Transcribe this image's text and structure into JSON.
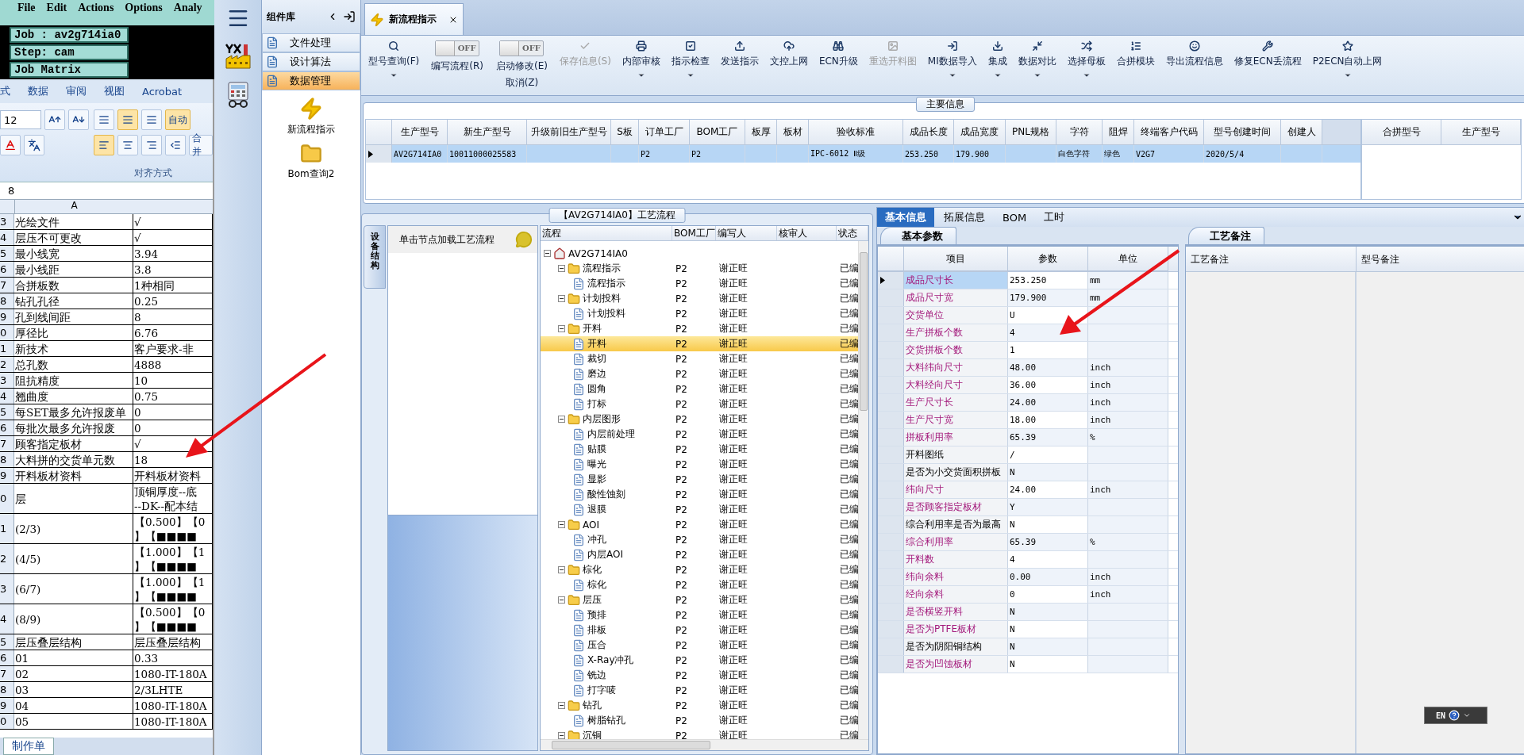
{
  "terminal": {
    "menu": [
      "File",
      "Edit",
      "Actions",
      "Options",
      "Analy"
    ],
    "job": "Job : av2g714ia0",
    "step": "Step: cam",
    "matrix": "Job Matrix"
  },
  "spreadsheet": {
    "ribbon_tabs": [
      "式",
      "数据",
      "审阅",
      "视图",
      "Acrobat"
    ],
    "font_size": "12",
    "wrap_button": "自动",
    "merge_button": "合并",
    "group_label": "对齐方式",
    "formula_value": "8",
    "column_header": "A",
    "rows": [
      {
        "num": "3",
        "a": "光绘文件",
        "b": "√"
      },
      {
        "num": "4",
        "a": "层压不可更改",
        "b": "√"
      },
      {
        "num": "5",
        "a": "最小线宽",
        "b": "3.94"
      },
      {
        "num": "6",
        "a": "最小线距",
        "b": "3.8"
      },
      {
        "num": "7",
        "a": "合拼板数",
        "b": "1种相同"
      },
      {
        "num": "8",
        "a": "钻孔孔径",
        "b": "0.25"
      },
      {
        "num": "9",
        "a": "孔到线间距",
        "b": "8"
      },
      {
        "num": "0",
        "a": "厚径比",
        "b": "6.76"
      },
      {
        "num": "1",
        "a": "新技术",
        "b": "客户要求-非"
      },
      {
        "num": "2",
        "a": "总孔数",
        "b": "4888"
      },
      {
        "num": "3",
        "a": "阻抗精度",
        "b": "10"
      },
      {
        "num": "4",
        "a": "翘曲度",
        "b": "0.75"
      },
      {
        "num": "5",
        "a": "每SET最多允许报废单",
        "b": "0"
      },
      {
        "num": "6",
        "a": "每批次最多允许报废",
        "b": "0"
      },
      {
        "num": "7",
        "a": "顾客指定板材",
        "b": "√"
      },
      {
        "num": "8",
        "a": "大料拼的交货单元数",
        "b": "18"
      },
      {
        "num": "9",
        "a": "开料板材资料",
        "b": "开料板材资料"
      },
      {
        "num": "0",
        "a": "层",
        "b": "顶铜厚度--底",
        "b2": "--DK--配本结"
      },
      {
        "num": "1",
        "a": "(2/3)",
        "b": "【0.500】【0",
        "b2": "】【■■■■"
      },
      {
        "num": "2",
        "a": "(4/5)",
        "b": "【1.000】【1",
        "b2": "】【■■■■"
      },
      {
        "num": "3",
        "a": "(6/7)",
        "b": "【1.000】【1",
        "b2": "】【■■■■"
      },
      {
        "num": "4",
        "a": "(8/9)",
        "b": "【0.500】【0",
        "b2": "】【■■■■"
      },
      {
        "num": "5",
        "a": "层压叠层结构",
        "b": "层压叠层结构"
      },
      {
        "num": "6",
        "a": "01",
        "b": "0.33"
      },
      {
        "num": "7",
        "a": "02",
        "b": "1080-IT-180A"
      },
      {
        "num": "8",
        "a": "03",
        "b": "2/3LHTE"
      },
      {
        "num": "9",
        "a": "04",
        "b": "1080-IT-180A"
      },
      {
        "num": "0",
        "a": "05",
        "b": "1080-IT-180A"
      }
    ],
    "sheet_tab": "制作单"
  },
  "component_panel": {
    "title": "组件库",
    "categories": [
      {
        "label": "文件处理",
        "selected": false
      },
      {
        "label": "设计算法",
        "selected": false
      },
      {
        "label": "数据管理",
        "selected": true
      }
    ],
    "modules": [
      {
        "label": "新流程指示",
        "kind": "flow"
      },
      {
        "label": "Bom查询2",
        "kind": "folder"
      }
    ]
  },
  "document_tab": {
    "title": "新流程指示"
  },
  "toolbar": [
    {
      "kind": "button",
      "label": "型号查询(F)",
      "dropdown": true,
      "disabled": false
    },
    {
      "kind": "toggle",
      "label": "编写流程(R)",
      "state_text": "OFF",
      "on": false
    },
    {
      "kind": "toggle",
      "label": "启动修改(E)",
      "sublabel": "取消(Z)",
      "state_text": "OFF",
      "on": false
    },
    {
      "kind": "button",
      "label": "保存信息(S)",
      "dropdown": false,
      "disabled": true
    },
    {
      "kind": "button",
      "label": "内部审核",
      "dropdown": true,
      "disabled": false
    },
    {
      "kind": "button",
      "label": "指示检查",
      "dropdown": true,
      "disabled": false
    },
    {
      "kind": "button",
      "label": "发送指示",
      "dropdown": false,
      "disabled": false
    },
    {
      "kind": "button",
      "label": "文控上网",
      "dropdown": false,
      "disabled": false
    },
    {
      "kind": "button",
      "label": "ECN升级",
      "dropdown": false,
      "disabled": false
    },
    {
      "kind": "button",
      "label": "重选开料图",
      "dropdown": false,
      "disabled": true
    },
    {
      "kind": "button",
      "label": "MI数据导入",
      "dropdown": true,
      "disabled": false
    },
    {
      "kind": "button",
      "label": "集成",
      "dropdown": true,
      "disabled": false
    },
    {
      "kind": "button",
      "label": "数据对比",
      "dropdown": true,
      "disabled": false
    },
    {
      "kind": "button",
      "label": "选择母板",
      "dropdown": true,
      "disabled": false
    },
    {
      "kind": "button",
      "label": "合拼模块",
      "dropdown": false,
      "disabled": false
    },
    {
      "kind": "button",
      "label": "导出流程信息",
      "dropdown": false,
      "disabled": false
    },
    {
      "kind": "button",
      "label": "修复ECN丢流程",
      "dropdown": false,
      "disabled": false
    },
    {
      "kind": "button",
      "label": "P2ECN自动上网",
      "dropdown": true,
      "disabled": false
    }
  ],
  "main_info": {
    "title": "主要信息",
    "columns": [
      "生产型号",
      "新生产型号",
      "升级前旧生产型号",
      "S板",
      "订单工厂",
      "BOM工厂",
      "板厚",
      "板材",
      "验收标准",
      "成品长度",
      "成品宽度",
      "PNL规格",
      "字符",
      "阻焊",
      "终端客户代码",
      "型号创建时间",
      "创建人"
    ],
    "rows": [
      {
        "selected": true,
        "cells": [
          "AV2G714IA0",
          "10011000025583",
          null,
          null,
          "P2",
          "P2",
          null,
          null,
          "IPC-6012 Ⅱ级",
          "253.250",
          "179.900",
          null,
          "白色字符",
          "绿色",
          "V2G7",
          "2020/5/4",
          null
        ]
      }
    ],
    "merge_columns": [
      "合拼型号",
      "生产型号"
    ]
  },
  "process_flow": {
    "title": "【AV2G714IA0】工艺流程",
    "side_tab": "设备结构",
    "hint": "单击节点加载工艺流程",
    "columns": [
      "流程",
      "BOM工厂",
      "编写人",
      "核审人",
      "状态"
    ],
    "tree": {
      "label": "AV2G714IA0",
      "expanded": true,
      "selected": false,
      "children": [
        {
          "label": "流程指示",
          "bom": "P2",
          "author": "谢正旺",
          "status": "已编",
          "expanded": true,
          "selected": false,
          "children": [
            {
              "label": "流程指示",
              "bom": "P2",
              "author": "谢正旺",
              "status": "已编",
              "selected": false
            }
          ]
        },
        {
          "label": "计划投料",
          "bom": "P2",
          "author": "谢正旺",
          "status": "已编",
          "expanded": true,
          "selected": false,
          "children": [
            {
              "label": "计划投料",
              "bom": "P2",
              "author": "谢正旺",
              "status": "已编",
              "selected": false
            }
          ]
        },
        {
          "label": "开料",
          "bom": "P2",
          "author": "谢正旺",
          "status": "已编",
          "expanded": true,
          "selected": false,
          "children": [
            {
              "label": "开料",
              "bom": "P2",
              "author": "谢正旺",
              "status": "已编",
              "selected": true
            },
            {
              "label": "裁切",
              "bom": "P2",
              "author": "谢正旺",
              "status": "已编",
              "selected": false
            },
            {
              "label": "磨边",
              "bom": "P2",
              "author": "谢正旺",
              "status": "已编",
              "selected": false
            },
            {
              "label": "圆角",
              "bom": "P2",
              "author": "谢正旺",
              "status": "已编",
              "selected": false
            },
            {
              "label": "打标",
              "bom": "P2",
              "author": "谢正旺",
              "status": "已编",
              "selected": false
            }
          ]
        },
        {
          "label": "内层图形",
          "bom": "P2",
          "author": "谢正旺",
          "status": "已编",
          "expanded": true,
          "selected": false,
          "children": [
            {
              "label": "内层前处理",
              "bom": "P2",
              "author": "谢正旺",
              "status": "已编",
              "selected": false
            },
            {
              "label": "贴膜",
              "bom": "P2",
              "author": "谢正旺",
              "status": "已编",
              "selected": false
            },
            {
              "label": "曝光",
              "bom": "P2",
              "author": "谢正旺",
              "status": "已编",
              "selected": false
            },
            {
              "label": "显影",
              "bom": "P2",
              "author": "谢正旺",
              "status": "已编",
              "selected": false
            },
            {
              "label": "酸性蚀刻",
              "bom": "P2",
              "author": "谢正旺",
              "status": "已编",
              "selected": false
            },
            {
              "label": "退膜",
              "bom": "P2",
              "author": "谢正旺",
              "status": "已编",
              "selected": false
            }
          ]
        },
        {
          "label": "AOI",
          "bom": "P2",
          "author": "谢正旺",
          "status": "已编",
          "expanded": true,
          "selected": false,
          "children": [
            {
              "label": "冲孔",
              "bom": "P2",
              "author": "谢正旺",
              "status": "已编",
              "selected": false
            },
            {
              "label": "内层AOI",
              "bom": "P2",
              "author": "谢正旺",
              "status": "已编",
              "selected": false
            }
          ]
        },
        {
          "label": "棕化",
          "bom": "P2",
          "author": "谢正旺",
          "status": "已编",
          "expanded": true,
          "selected": false,
          "children": [
            {
              "label": "棕化",
              "bom": "P2",
              "author": "谢正旺",
              "status": "已编",
              "selected": false
            }
          ]
        },
        {
          "label": "层压",
          "bom": "P2",
          "author": "谢正旺",
          "status": "已编",
          "expanded": true,
          "selected": false,
          "children": [
            {
              "label": "预排",
              "bom": "P2",
              "author": "谢正旺",
              "status": "已编",
              "selected": false
            },
            {
              "label": "排板",
              "bom": "P2",
              "author": "谢正旺",
              "status": "已编",
              "selected": false
            },
            {
              "label": "压合",
              "bom": "P2",
              "author": "谢正旺",
              "status": "已编",
              "selected": false
            },
            {
              "label": "X-Ray冲孔",
              "bom": "P2",
              "author": "谢正旺",
              "status": "已编",
              "selected": false
            },
            {
              "label": "铣边",
              "bom": "P2",
              "author": "谢正旺",
              "status": "已编",
              "selected": false
            },
            {
              "label": "打字唛",
              "bom": "P2",
              "author": "谢正旺",
              "status": "已编",
              "selected": false
            }
          ]
        },
        {
          "label": "钻孔",
          "bom": "P2",
          "author": "谢正旺",
          "status": "已编",
          "expanded": true,
          "selected": false,
          "children": [
            {
              "label": "树脂钻孔",
              "bom": "P2",
              "author": "谢正旺",
              "status": "已编",
              "selected": false
            }
          ]
        },
        {
          "label": "沉铜",
          "bom": "P2",
          "author": "谢正旺",
          "status": "已编",
          "expanded": true,
          "selected": false
        }
      ]
    }
  },
  "details": {
    "tabs": [
      {
        "label": "基本信息",
        "selected": true
      },
      {
        "label": "拓展信息",
        "selected": false
      },
      {
        "label": "BOM",
        "selected": false
      },
      {
        "label": "工时",
        "selected": false
      }
    ],
    "params_tab": "基本参数",
    "columns": [
      "项目",
      "参数",
      "单位"
    ],
    "rows": [
      {
        "item": "成品尺寸长",
        "value": "253.250",
        "unit": "mm",
        "required": true,
        "selected": true
      },
      {
        "item": "成品尺寸宽",
        "value": "179.900",
        "unit": "mm",
        "required": true,
        "selected": false
      },
      {
        "item": "交货单位",
        "value": "U",
        "required": true,
        "selected": false
      },
      {
        "item": "生产拼板个数",
        "value": "4",
        "required": true,
        "selected": false
      },
      {
        "item": "交货拼板个数",
        "value": "1",
        "required": true,
        "selected": false
      },
      {
        "item": "大料纬向尺寸",
        "value": "48.00",
        "unit": "inch",
        "required": true,
        "selected": false
      },
      {
        "item": "大料经向尺寸",
        "value": "36.00",
        "unit": "inch",
        "required": true,
        "selected": false
      },
      {
        "item": "生产尺寸长",
        "value": "24.00",
        "unit": "inch",
        "required": true,
        "selected": false
      },
      {
        "item": "生产尺寸宽",
        "value": "18.00",
        "unit": "inch",
        "required": true,
        "selected": false
      },
      {
        "item": "拼板利用率",
        "value": "65.39",
        "unit": "%",
        "required": true,
        "selected": false
      },
      {
        "item": "开料图纸",
        "value": "/",
        "required": false,
        "selected": false
      },
      {
        "item": "是否为小交货面积拼板",
        "value": "N",
        "required": false,
        "selected": false
      },
      {
        "item": "纬向尺寸",
        "value": "24.00",
        "unit": "inch",
        "required": true,
        "selected": false
      },
      {
        "item": "是否顾客指定板材",
        "value": "Y",
        "required": true,
        "selected": false
      },
      {
        "item": "综合利用率是否为最高",
        "value": "N",
        "required": false,
        "selected": false
      },
      {
        "item": "综合利用率",
        "value": "65.39",
        "unit": "%",
        "required": true,
        "selected": false
      },
      {
        "item": "开料数",
        "value": "4",
        "required": true,
        "selected": false
      },
      {
        "item": "纬向余料",
        "value": "0.00",
        "unit": "inch",
        "required": true,
        "selected": false
      },
      {
        "item": "经向余料",
        "value": "0",
        "unit": "inch",
        "required": true,
        "selected": false
      },
      {
        "item": "是否横竖开料",
        "value": "N",
        "required": true,
        "selected": false
      },
      {
        "item": "是否为PTFE板材",
        "value": "N",
        "required": true,
        "selected": false
      },
      {
        "item": "是否为阴阳铜结构",
        "value": "N",
        "required": false,
        "selected": false
      },
      {
        "item": "是否为凹蚀板材",
        "value": "N",
        "required": true,
        "selected": false
      }
    ],
    "notes_tab": "工艺备注",
    "notes_columns": [
      "工艺备注",
      "型号备注"
    ]
  },
  "language_bar": {
    "label": "EN"
  }
}
